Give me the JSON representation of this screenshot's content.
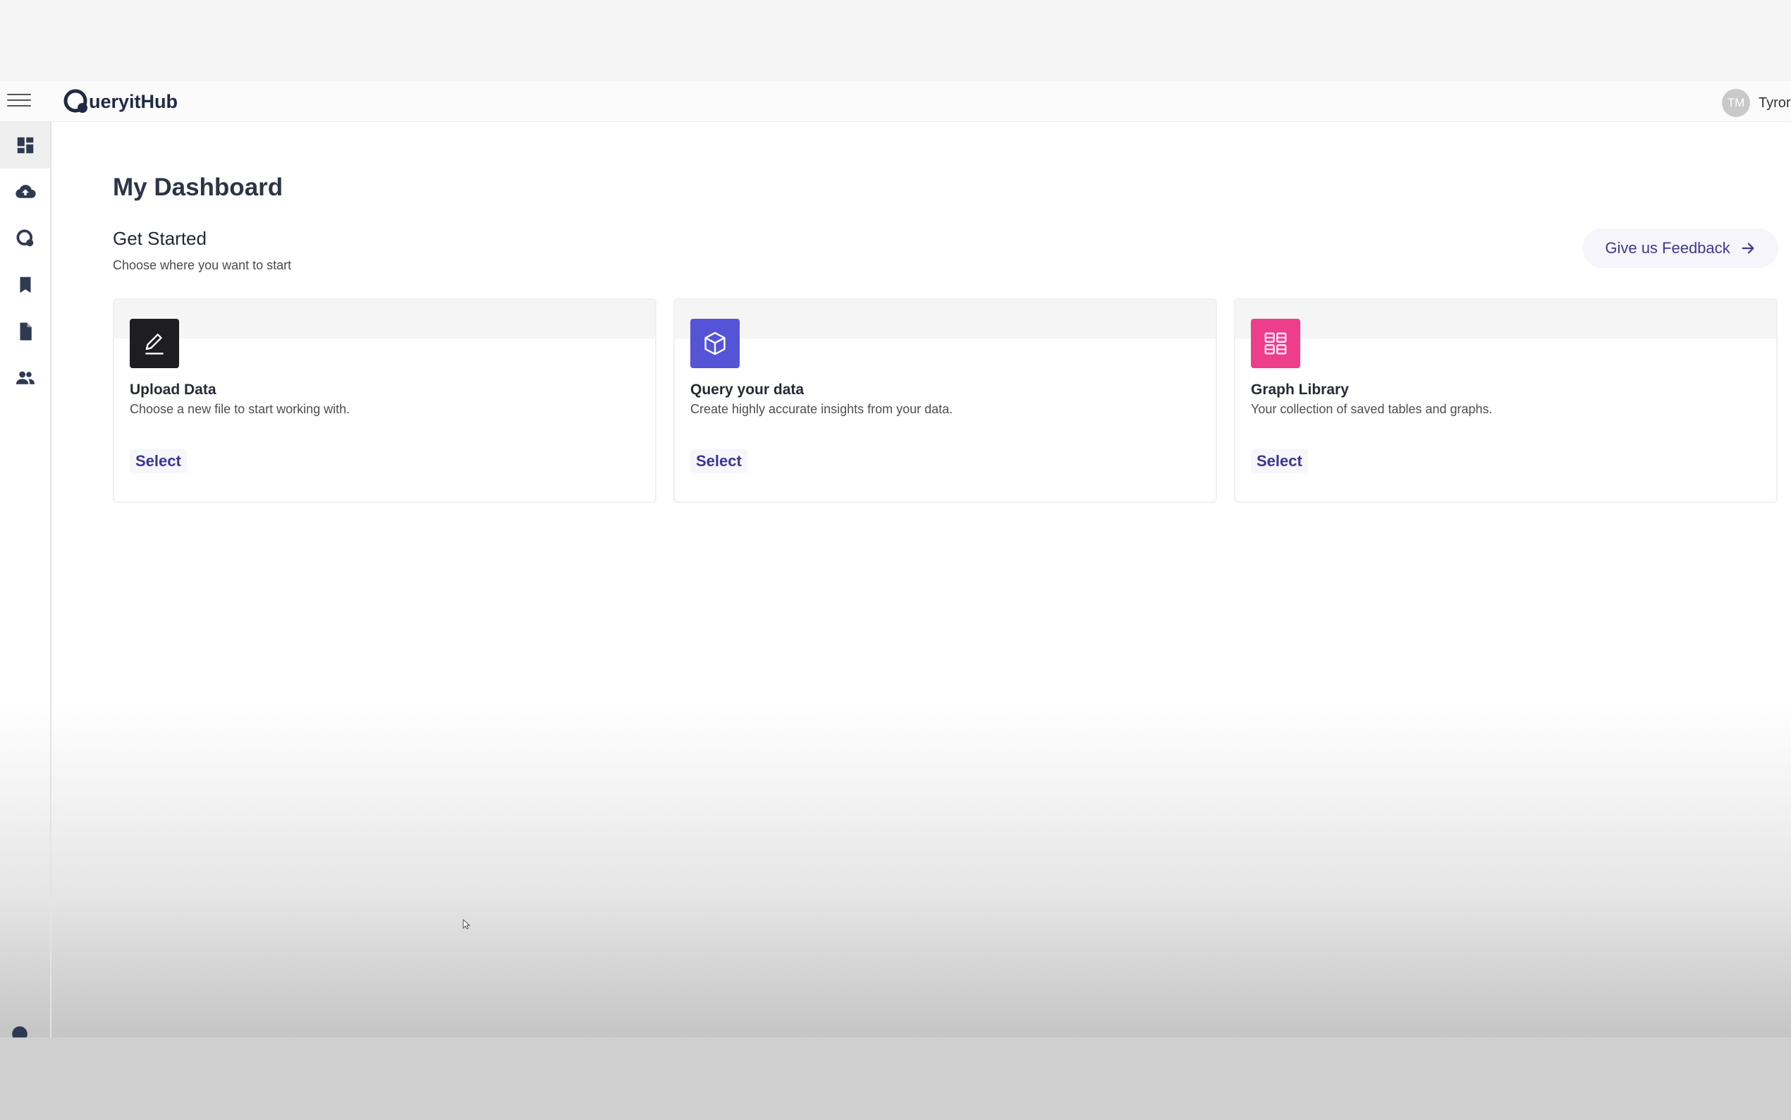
{
  "app": {
    "name": "QueryitHub",
    "logo_text": "ueryitHub"
  },
  "header": {
    "avatar_initials": "TM",
    "username": "Tyror"
  },
  "sidebar": {
    "items": [
      {
        "icon": "dashboard-icon",
        "active": true
      },
      {
        "icon": "cloud-upload-icon",
        "active": false
      },
      {
        "icon": "query-logo-icon",
        "active": false
      },
      {
        "icon": "bookmark-icon",
        "active": false
      },
      {
        "icon": "document-icon",
        "active": false
      },
      {
        "icon": "people-icon",
        "active": false
      }
    ]
  },
  "main": {
    "title": "My Dashboard",
    "section_title": "Get Started",
    "section_subtitle": "Choose where you want to start",
    "feedback_label": "Give us Feedback",
    "cards": [
      {
        "title": "Upload Data",
        "description": "Choose a new file to start working with.",
        "action": "Select",
        "icon": "pen-icon",
        "icon_color": "#1e1d22"
      },
      {
        "title": "Query your data",
        "description": "Create highly accurate insights from your data.",
        "action": "Select",
        "icon": "cube-icon",
        "icon_color": "#5553d8"
      },
      {
        "title": "Graph Library",
        "description": "Your collection of saved tables and graphs.",
        "action": "Select",
        "icon": "grid-icon",
        "icon_color": "#ee3d8b"
      }
    ]
  },
  "colors": {
    "accent": "#3d3a8c",
    "text_dark": "#2b3545"
  }
}
